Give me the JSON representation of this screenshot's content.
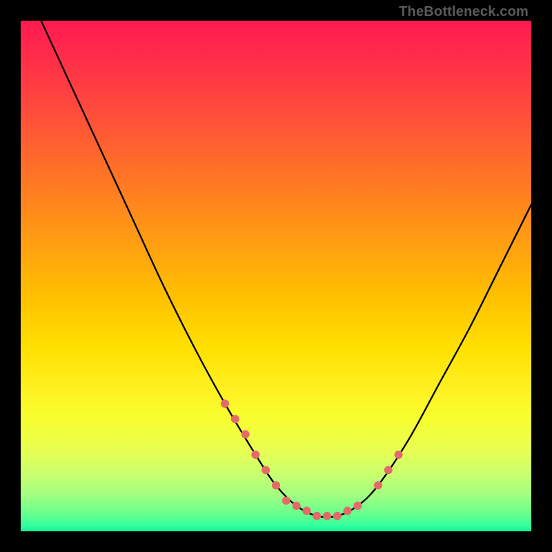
{
  "attribution": "TheBottleneck.com",
  "chart_data": {
    "type": "line",
    "title": "",
    "xlabel": "",
    "ylabel": "",
    "xlim": [
      0,
      100
    ],
    "ylim": [
      0,
      100
    ],
    "grid": false,
    "legend": false,
    "series": [
      {
        "name": "bottleneck-curve",
        "color": "#000000",
        "x": [
          4,
          10,
          16,
          22,
          28,
          34,
          40,
          46,
          50,
          54,
          58,
          62,
          66,
          70,
          76,
          82,
          88,
          94,
          100
        ],
        "y": [
          100,
          87,
          74,
          61,
          48,
          36,
          25,
          15,
          9,
          5,
          3,
          3,
          5,
          9,
          18,
          29,
          40,
          52,
          64
        ]
      }
    ],
    "markers": {
      "name": "highlight-dots",
      "color": "#e46a6a",
      "x": [
        40,
        42,
        44,
        46,
        48,
        50,
        52,
        54,
        56,
        58,
        60,
        62,
        64,
        66,
        70,
        72,
        74
      ],
      "y": [
        25,
        22,
        19,
        15,
        12,
        9,
        6,
        5,
        4,
        3,
        3,
        3,
        4,
        5,
        9,
        12,
        15
      ]
    },
    "gradient_bands": [
      {
        "offset": 0.0,
        "color": "#ff1a52"
      },
      {
        "offset": 0.5,
        "color": "#ffc000"
      },
      {
        "offset": 0.8,
        "color": "#f0ff40"
      },
      {
        "offset": 1.0,
        "color": "#10f090"
      }
    ]
  }
}
